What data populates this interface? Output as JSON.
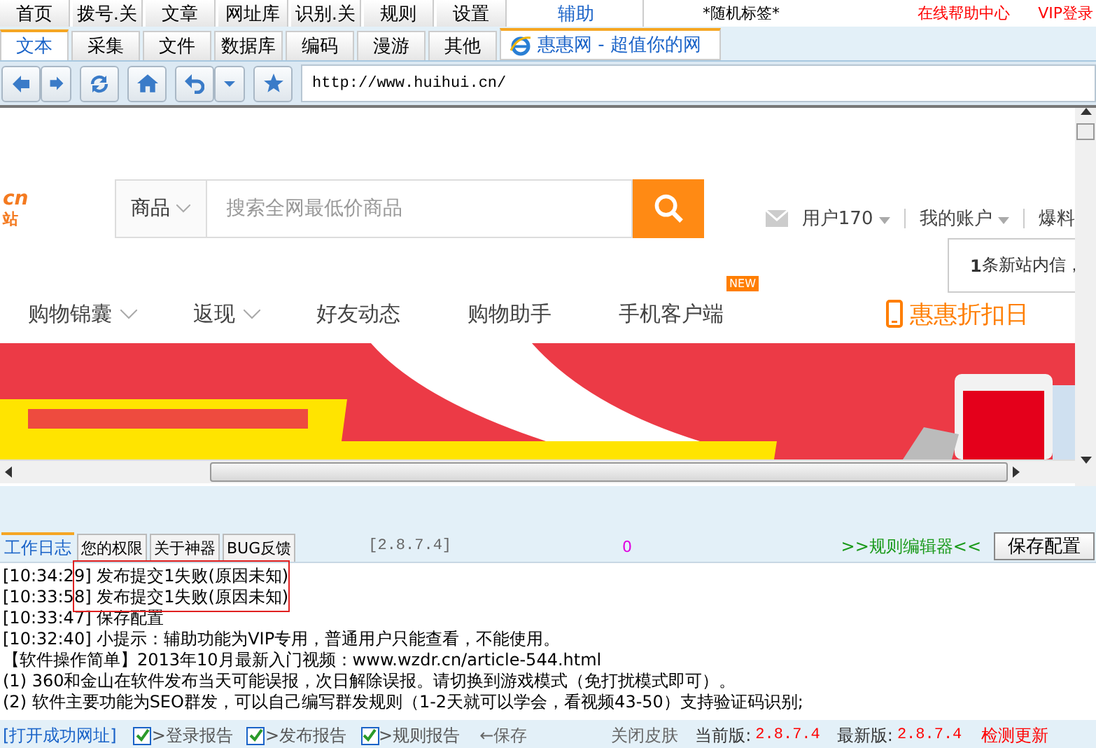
{
  "menu_tabs": [
    {
      "label": "首页",
      "selected": false
    },
    {
      "label": "拨号.关",
      "selected": false
    },
    {
      "label": "文章",
      "selected": false
    },
    {
      "label": "网址库",
      "selected": false
    },
    {
      "label": "识别.关",
      "selected": false
    },
    {
      "label": "规则",
      "selected": false
    },
    {
      "label": "设置",
      "selected": false
    },
    {
      "label": "辅助",
      "selected": true
    }
  ],
  "random_tag": "*随机标签*",
  "help_link": "在线帮助中心",
  "vip_link": "VIP登录",
  "sub_tabs": [
    {
      "label": "文本",
      "selected": true
    },
    {
      "label": "采集",
      "selected": false
    },
    {
      "label": "文件",
      "selected": false
    },
    {
      "label": "数据库",
      "selected": false
    },
    {
      "label": "编码",
      "selected": false
    },
    {
      "label": "漫游",
      "selected": false
    },
    {
      "label": "其他",
      "selected": false
    }
  ],
  "browser_tab": {
    "title": "惠惠网 - 超值你的网",
    "selected": true
  },
  "address": "http://www.huihui.cn/",
  "webpage": {
    "logo_top": "cn",
    "logo_bottom": "站",
    "search_category": "商品",
    "search_placeholder": "搜索全网最低价商品",
    "user": "用户170",
    "account": "我的账户",
    "report": "爆料",
    "message_count": "1",
    "message_text": "条新站内信，",
    "nav": [
      {
        "label": "购物锦囊",
        "dropdown": true
      },
      {
        "label": "返现",
        "dropdown": true
      },
      {
        "label": "好友动态",
        "dropdown": false
      },
      {
        "label": "购物助手",
        "dropdown": false
      },
      {
        "label": "手机客户端",
        "dropdown": false,
        "badge": "NEW"
      }
    ],
    "promo": "惠惠折扣日"
  },
  "bottom_tabs": [
    {
      "label": "工作日志",
      "selected": true
    },
    {
      "label": "您的权限",
      "selected": false
    },
    {
      "label": "关于神器",
      "selected": false
    },
    {
      "label": "BUG反馈",
      "selected": false
    }
  ],
  "version_tag": "[2.8.7.4]",
  "counter": "0",
  "rule_editor": ">>规则编辑器<<",
  "save_config": "保存配置",
  "log": {
    "marked": [
      "[10:34:29] 发布提交1失败(原因未知)",
      "[10:33:58] 发布提交1失败(原因未知)"
    ],
    "lines": [
      "[10:33:47] 保存配置",
      "[10:32:40] 小提示：辅助功能为VIP专用，普通用户只能查看，不能使用。",
      "【软件操作简单】2013年10月最新入门视频：www.wzdr.cn/article-544.html",
      "(1) 360和金山在软件发布当天可能误报，次日解除误报。请切换到游戏模式（免打扰模式即可）。",
      "(2) 软件主要功能为SEO群发，可以自己编写群发规则（1-2天就可以学会，看视频43-50）支持验证码识别;"
    ]
  },
  "status": {
    "open_link": "[打开成功网址]",
    "checks": [
      {
        "label": ">登录报告",
        "checked": true
      },
      {
        "label": ">发布报告",
        "checked": true
      },
      {
        "label": ">规则报告",
        "checked": true
      }
    ],
    "save": "←保存",
    "skin": "关闭皮肤",
    "current_label": "当前版:",
    "current": "2.8.7.4",
    "latest_label": "最新版:",
    "latest": "2.8.7.4",
    "update": "检测更新"
  }
}
